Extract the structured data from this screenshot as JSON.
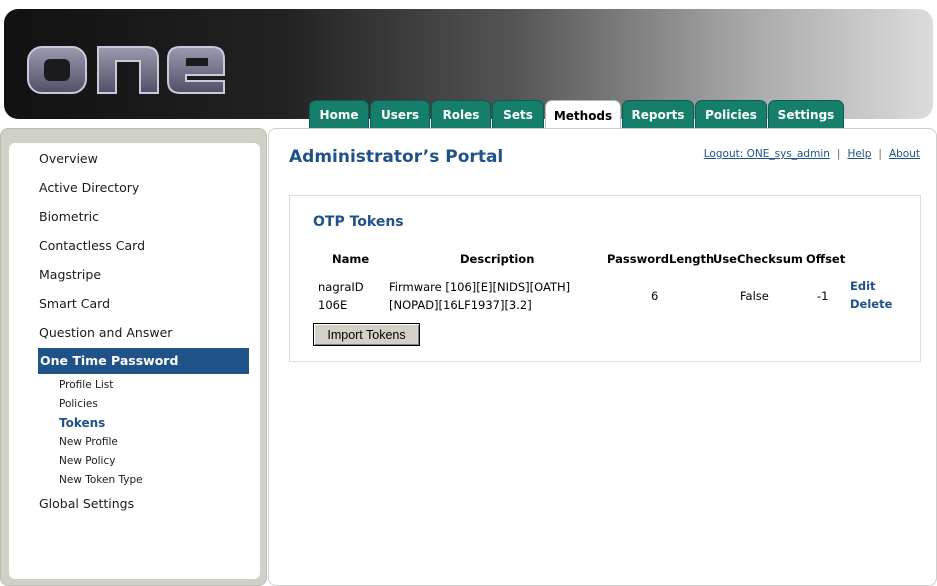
{
  "logo_text": "one",
  "tabs": [
    {
      "label": "Home"
    },
    {
      "label": "Users"
    },
    {
      "label": "Roles"
    },
    {
      "label": "Sets"
    },
    {
      "label": "Methods",
      "active": true
    },
    {
      "label": "Reports"
    },
    {
      "label": "Policies"
    },
    {
      "label": "Settings"
    }
  ],
  "sidebar": {
    "items": [
      {
        "label": "Overview"
      },
      {
        "label": "Active Directory"
      },
      {
        "label": "Biometric"
      },
      {
        "label": "Contactless Card"
      },
      {
        "label": "Magstripe"
      },
      {
        "label": "Smart Card"
      },
      {
        "label": "Question and Answer"
      },
      {
        "label": "One Time Password",
        "active": true
      },
      {
        "label": "Global Settings"
      }
    ],
    "subitems": [
      {
        "label": "Profile List"
      },
      {
        "label": "Policies"
      },
      {
        "label": "Tokens",
        "active": true
      },
      {
        "label": "New Profile"
      },
      {
        "label": "New Policy"
      },
      {
        "label": "New Token Type"
      }
    ]
  },
  "page": {
    "title": "Administrator’s Portal",
    "links": {
      "logout": "Logout: ONE_sys_admin",
      "help": "Help",
      "about": "About"
    }
  },
  "panel": {
    "title": "OTP Tokens",
    "columns": [
      "Name",
      "Description",
      "PasswordLength",
      "UseChecksum",
      "Offset"
    ],
    "rows": [
      {
        "name_line1": "nagraID",
        "name_line2": "106E",
        "description_line1": "Firmware [106][E][NIDS][OATH]",
        "description_line2": "[NOPAD][16LF1937][3.2]",
        "password_length": "6",
        "use_checksum": "False",
        "offset": "-1",
        "edit_label": "Edit",
        "delete_label": "Delete"
      }
    ],
    "import_button": "Import Tokens"
  },
  "colors": {
    "tab_green": "#157f6c",
    "nav_active": "#1f5289",
    "link_blue": "#1f5289"
  }
}
